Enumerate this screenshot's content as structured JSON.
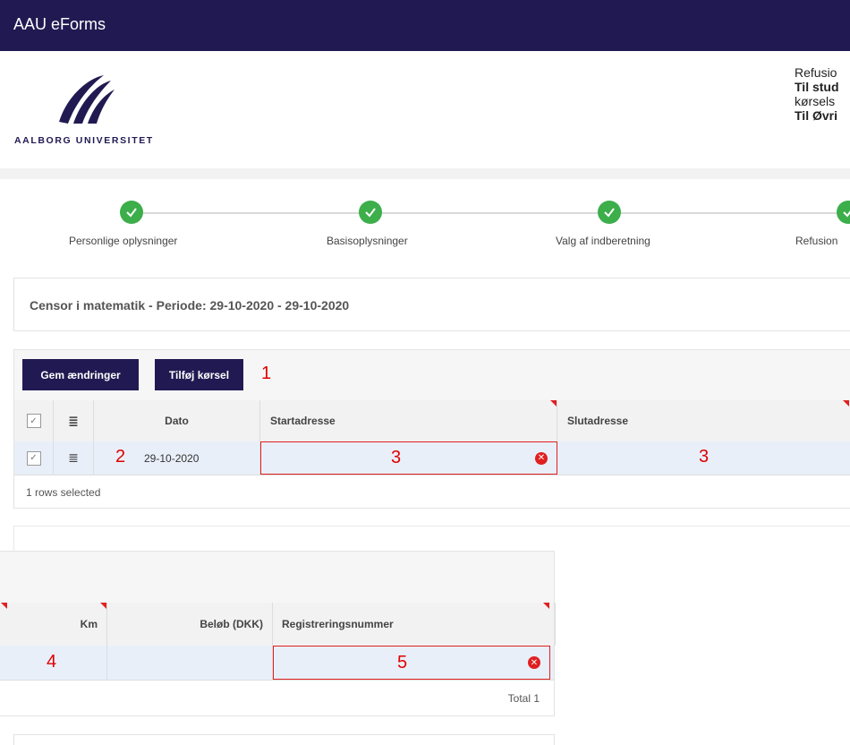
{
  "app": {
    "title": "AAU eForms"
  },
  "logo": {
    "text": "AALBORG UNIVERSITET"
  },
  "info": {
    "line1": "Refusio",
    "line2": "Til stud",
    "line3": "kørsels",
    "line4": "Til Øvri"
  },
  "steps": [
    {
      "label": "Personlige oplysninger",
      "done": true
    },
    {
      "label": "Basisoplysninger",
      "done": true
    },
    {
      "label": "Valg af indberetning",
      "done": true
    },
    {
      "label": "Refusion",
      "done": true
    }
  ],
  "period": {
    "text": "Censor i matematik - Periode: 29-10-2020 - 29-10-2020"
  },
  "toolbar": {
    "save_label": "Gem ændringer",
    "add_label": "Tilføj kørsel"
  },
  "grid1": {
    "columns": {
      "date": "Dato",
      "start": "Startadresse",
      "end": "Slutadresse"
    },
    "rows": [
      {
        "date": "29-10-2020",
        "start": "",
        "end": ""
      }
    ],
    "footer": "1 rows selected"
  },
  "grid2": {
    "columns": {
      "km": "Km",
      "amount": "Beløb (DKK)",
      "reg": "Registreringsnummer"
    },
    "rows": [
      {
        "km": "",
        "amount": "",
        "reg": ""
      }
    ],
    "footer": "Total 1"
  },
  "annotations": {
    "a1": "1",
    "a2": "2",
    "a3": "3",
    "a4": "4",
    "a5": "5"
  },
  "colors": {
    "brand": "#211a52",
    "success": "#3cae4a",
    "error": "#e02020",
    "selected_row": "#e9eff9"
  }
}
